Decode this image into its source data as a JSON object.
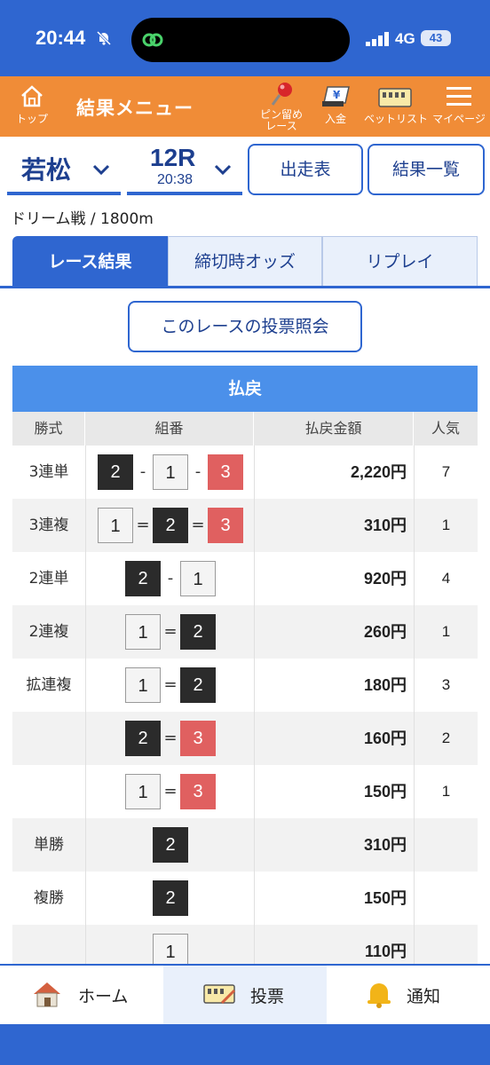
{
  "status_bar": {
    "time": "20:44",
    "network": "4G",
    "battery": "43"
  },
  "top_menu": {
    "home_label": "トップ",
    "title": "結果メニュー",
    "pin_label_line1": "ピン留め",
    "pin_label_line2": "レース",
    "deposit_label": "入金",
    "betlist_label": "ベットリスト",
    "mypage_label": "マイページ"
  },
  "race": {
    "venue": "若松",
    "race_no": "12R",
    "race_time": "20:38",
    "entry_table_label": "出走表",
    "results_list_label": "結果一覧",
    "subinfo": "ドリーム戦 / 1800m"
  },
  "tabs": [
    {
      "label": "レース結果",
      "active": true
    },
    {
      "label": "締切時オッズ",
      "active": false
    },
    {
      "label": "リプレイ",
      "active": false
    }
  ],
  "inquiry_button": "このレースの投票照会",
  "payout": {
    "title": "払戻",
    "headers": [
      "勝式",
      "組番",
      "払戻金額",
      "人気"
    ],
    "rows": [
      {
        "type": "3連単",
        "combo": [
          "2",
          "-",
          "1",
          "-",
          "3"
        ],
        "amount": "2,220円",
        "pop": "7"
      },
      {
        "type": "3連複",
        "combo": [
          "1",
          "=",
          "2",
          "=",
          "3"
        ],
        "amount": "310円",
        "pop": "1"
      },
      {
        "type": "2連単",
        "combo": [
          "2",
          "-",
          "1"
        ],
        "amount": "920円",
        "pop": "4"
      },
      {
        "type": "2連複",
        "combo": [
          "1",
          "=",
          "2"
        ],
        "amount": "260円",
        "pop": "1"
      },
      {
        "type": "拡連複",
        "combo": [
          "1",
          "=",
          "2"
        ],
        "amount": "180円",
        "pop": "3"
      },
      {
        "type": "",
        "combo": [
          "2",
          "=",
          "3"
        ],
        "amount": "160円",
        "pop": "2"
      },
      {
        "type": "",
        "combo": [
          "1",
          "=",
          "3"
        ],
        "amount": "150円",
        "pop": "1"
      },
      {
        "type": "単勝",
        "combo": [
          "2"
        ],
        "amount": "310円",
        "pop": ""
      },
      {
        "type": "複勝",
        "combo": [
          "2"
        ],
        "amount": "150円",
        "pop": ""
      },
      {
        "type": "",
        "combo": [
          "1"
        ],
        "amount": "110円",
        "pop": ""
      }
    ]
  },
  "bottom_nav": {
    "home": "ホーム",
    "vote": "投票",
    "notify": "通知"
  },
  "colors": {
    "primary": "#2f66d0",
    "orange": "#f08c37",
    "boat1": "#f4f4f4",
    "boat2": "#2b2b2b",
    "boat3": "#e06060"
  }
}
